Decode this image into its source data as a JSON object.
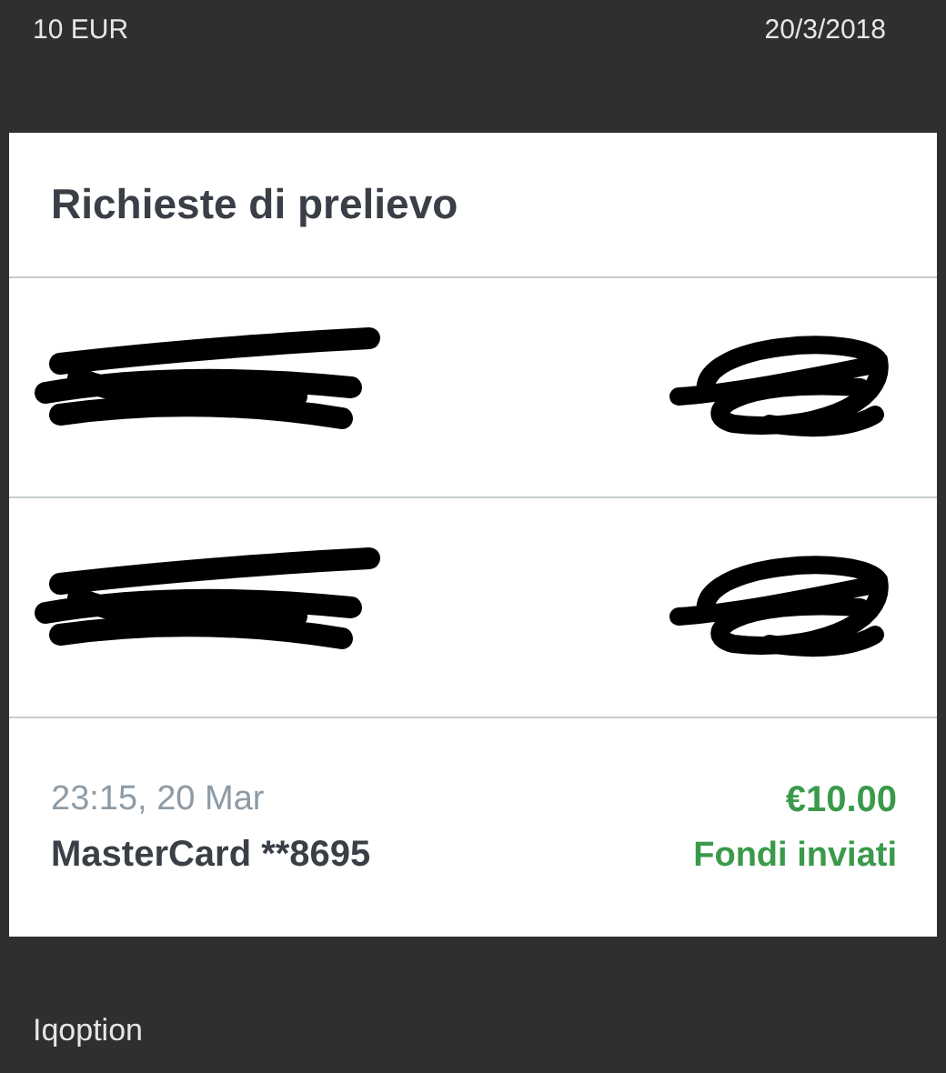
{
  "caption": {
    "amount": "10 EUR",
    "date": "20/3/2018",
    "broker": "Iqoption"
  },
  "card": {
    "title": "Richieste di prelievo",
    "rows": [
      {
        "kind": "redacted"
      },
      {
        "kind": "redacted"
      },
      {
        "kind": "transaction",
        "time": "23:15, 20 Mar",
        "method": "MasterCard **8695",
        "amount": "€10.00",
        "status": "Fondi inviati"
      }
    ]
  }
}
